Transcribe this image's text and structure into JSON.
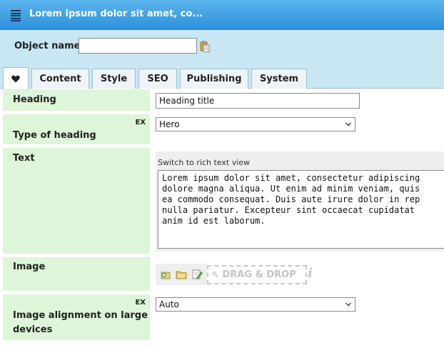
{
  "window": {
    "title": "Lorem ipsum dolor sit amet, co..."
  },
  "object_name": {
    "label": "Object name",
    "value": "",
    "placeholder": ""
  },
  "tabs": [
    {
      "label": "",
      "icon": "heart-icon",
      "active": true
    },
    {
      "label": "Content"
    },
    {
      "label": "Style"
    },
    {
      "label": "SEO"
    },
    {
      "label": "Publishing"
    },
    {
      "label": "System"
    }
  ],
  "fields": {
    "heading": {
      "label": "Heading",
      "value": "Heading title"
    },
    "type_of_heading": {
      "label": "Type of heading",
      "badge": "EX",
      "value": "Hero"
    },
    "text": {
      "label": "Text",
      "switch_label": "Switch to rich text view",
      "value": "Lorem ipsum dolor sit amet, consectetur adipiscing\ndolore magna aliqua. Ut enim ad minim veniam, quis\nea commodo consequat. Duis aute irure dolor in rep\nnulla pariatur. Excepteur sint occaecat cupidatat \nanim id est laborum."
    },
    "image": {
      "label": "Image",
      "dropzone": "⇖ DRAG & DROP",
      "info": "i"
    },
    "image_alignment": {
      "label_line1": "Image alignment on large",
      "label_line2": "devices",
      "badge": "EX",
      "value": "Auto"
    }
  },
  "colors": {
    "titlebar": "#3a9be0",
    "namebar": "#c9e6f3",
    "label_bg": "#ddf5d8"
  }
}
